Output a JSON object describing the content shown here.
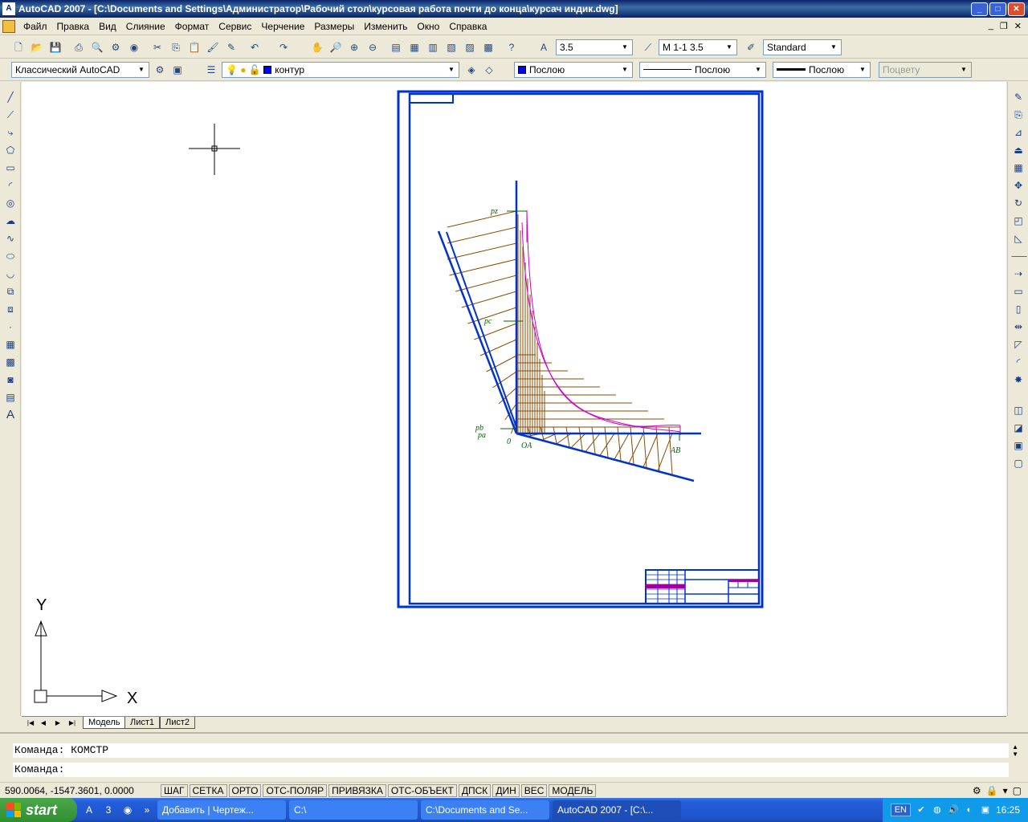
{
  "window": {
    "title": "AutoCAD 2007 - [C:\\Documents and Settings\\Администратор\\Рабочий стол\\курсовая работа почти до конца\\курсач индик.dwg]",
    "app_icon": "autocad-icon"
  },
  "menu": [
    "Файл",
    "Правка",
    "Вид",
    "Слияние",
    "Формат",
    "Сервис",
    "Черчение",
    "Размеры",
    "Изменить",
    "Окно",
    "Справка"
  ],
  "toolbar": {
    "text_height": "3.5",
    "dim_style": "М 1-1 3.5",
    "table_style": "Standard",
    "workspace": "Классический AutoCAD",
    "layer": "контур",
    "color": "Послою",
    "linetype": "Послою",
    "lineweight": "Послою",
    "plotstyle": "Поцвету"
  },
  "drawing": {
    "labels": [
      "pz",
      "pc",
      "pb",
      "pa",
      "0",
      "OA",
      "AB"
    ],
    "colors": {
      "frame": "#0033cc",
      "hatch": "#8b4a00",
      "curve": "#cc00cc",
      "labels": "#006600"
    }
  },
  "ucs": {
    "x_label": "X",
    "y_label": "Y"
  },
  "layout_tabs": [
    "Модель",
    "Лист1",
    "Лист2"
  ],
  "command": {
    "history": "Команда: КОМСТР",
    "prompt": "Команда:"
  },
  "status": {
    "coords": "590.0064, -1547.3601, 0.0000",
    "buttons": [
      "ШАГ",
      "СЕТКА",
      "ОРТО",
      "ОТС-ПОЛЯР",
      "ПРИВЯЗКА",
      "ОТС-ОБЪЕКТ",
      "ДПСК",
      "ДИН",
      "ВЕС",
      "МОДЕЛЬ"
    ]
  },
  "taskbar": {
    "start": "start",
    "tasks": [
      "Добавить | Чертеж...",
      "C:\\",
      "C:\\Documents and Se...",
      "AutoCAD 2007 - [C:\\..."
    ],
    "lang": "EN",
    "time": "16:25"
  }
}
